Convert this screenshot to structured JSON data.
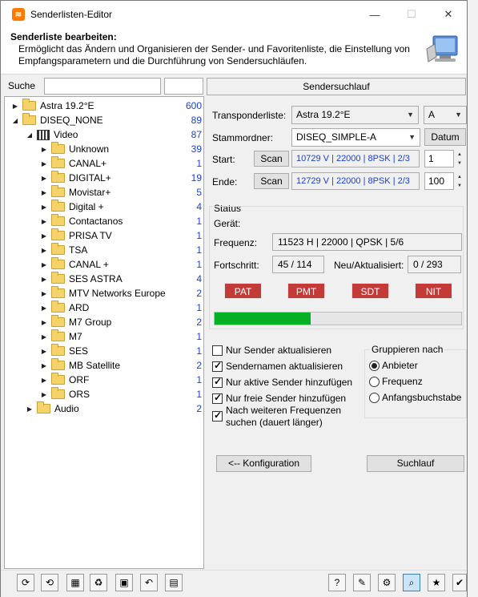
{
  "window": {
    "title": "Senderlisten-Editor",
    "min": "—",
    "max": "☐",
    "close": "✕"
  },
  "header": {
    "title": "Senderliste bearbeiten:",
    "desc": "Ermöglicht das Ändern und Organisieren der Sender- und Favoritenliste, die Einstellung von Empfangsparametern und die Durchführung von Sendersuchläufen."
  },
  "search": {
    "label": "Suche",
    "value": "",
    "value2": ""
  },
  "tree": [
    {
      "label": "Astra 19.2°E",
      "count": "600",
      "level": 0,
      "exp": "▶",
      "icon": "folder"
    },
    {
      "label": "DISEQ_NONE",
      "count": "89",
      "level": 0,
      "exp": "◢",
      "icon": "folder"
    },
    {
      "label": "Video",
      "count": "87",
      "level": 1,
      "exp": "◢",
      "icon": "clapper"
    },
    {
      "label": "Unknown",
      "count": "39",
      "level": 2,
      "exp": "▶",
      "icon": "folder"
    },
    {
      "label": "CANAL+",
      "count": "1",
      "level": 2,
      "exp": "▶",
      "icon": "folder"
    },
    {
      "label": "DIGITAL+",
      "count": "19",
      "level": 2,
      "exp": "▶",
      "icon": "folder"
    },
    {
      "label": "Movistar+",
      "count": "5",
      "level": 2,
      "exp": "▶",
      "icon": "folder"
    },
    {
      "label": "Digital +",
      "count": "4",
      "level": 2,
      "exp": "▶",
      "icon": "folder"
    },
    {
      "label": "Contactanos",
      "count": "1",
      "level": 2,
      "exp": "▶",
      "icon": "folder"
    },
    {
      "label": "PRISA TV",
      "count": "1",
      "level": 2,
      "exp": "▶",
      "icon": "folder"
    },
    {
      "label": "TSA",
      "count": "1",
      "level": 2,
      "exp": "▶",
      "icon": "folder"
    },
    {
      "label": "CANAL +",
      "count": "1",
      "level": 2,
      "exp": "▶",
      "icon": "folder"
    },
    {
      "label": "SES ASTRA",
      "count": "4",
      "level": 2,
      "exp": "▶",
      "icon": "folder"
    },
    {
      "label": "MTV Networks Europe",
      "count": "2",
      "level": 2,
      "exp": "▶",
      "icon": "folder"
    },
    {
      "label": "ARD",
      "count": "1",
      "level": 2,
      "exp": "▶",
      "icon": "folder"
    },
    {
      "label": "M7 Group",
      "count": "2",
      "level": 2,
      "exp": "▶",
      "icon": "folder"
    },
    {
      "label": "M7",
      "count": "1",
      "level": 2,
      "exp": "▶",
      "icon": "folder"
    },
    {
      "label": "SES",
      "count": "1",
      "level": 2,
      "exp": "▶",
      "icon": "folder"
    },
    {
      "label": "MB Satellite",
      "count": "2",
      "level": 2,
      "exp": "▶",
      "icon": "folder"
    },
    {
      "label": "ORF",
      "count": "1",
      "level": 2,
      "exp": "▶",
      "icon": "folder"
    },
    {
      "label": "ORS",
      "count": "1",
      "level": 2,
      "exp": "▶",
      "icon": "folder"
    },
    {
      "label": "Audio",
      "count": "2",
      "level": 1,
      "exp": "▶",
      "icon": "folder"
    }
  ],
  "scan": {
    "tab": "Sendersuchlauf",
    "transponder_label": "Transponderliste:",
    "transponder_value": "Astra 19.2°E",
    "transponder_sub": "A",
    "stamm_label": "Stammordner:",
    "stamm_value": "DISEQ_SIMPLE-A",
    "datum_btn": "Datum",
    "start_label": "Start:",
    "end_label": "Ende:",
    "scan_btn": "Scan",
    "start_value": "10729 V | 22000 | 8PSK | 2/3",
    "end_value": "12729 V | 22000 | 8PSK | 2/3",
    "start_num": "1",
    "end_num": "100"
  },
  "status": {
    "title": "Status",
    "device_label": "Gerät:",
    "freq_label": "Frequenz:",
    "freq_value": "11523 H | 22000 | QPSK | 5/6",
    "progress_label": "Fortschritt:",
    "progress_value": "45 / 114",
    "new_label": "Neu/Aktualisiert:",
    "new_value": "0 / 293",
    "tags": [
      "PAT",
      "PMT",
      "SDT",
      "NIT"
    ],
    "progress_fraction": 0.39
  },
  "options": [
    {
      "label": "Nur Sender aktualisieren",
      "checked": false
    },
    {
      "label": "Sendernamen aktualisieren",
      "checked": true
    },
    {
      "label": "Nur aktive Sender hinzufügen",
      "checked": true
    },
    {
      "label": "Nur freie Sender hinzufügen",
      "checked": true
    },
    {
      "label": "Nach weiteren Frequenzen suchen (dauert länger)",
      "checked": true
    }
  ],
  "group": {
    "title": "Gruppieren nach",
    "options": [
      {
        "label": "Anbieter",
        "selected": true
      },
      {
        "label": "Frequenz",
        "selected": false
      },
      {
        "label": "Anfangsbuchstabe",
        "selected": false
      }
    ]
  },
  "buttons": {
    "config": "<-- Konfiguration",
    "scan": "Suchlauf"
  },
  "colors": {
    "accent": "#1a3fd6",
    "tag": "#c33b38",
    "progress": "#06b025"
  }
}
